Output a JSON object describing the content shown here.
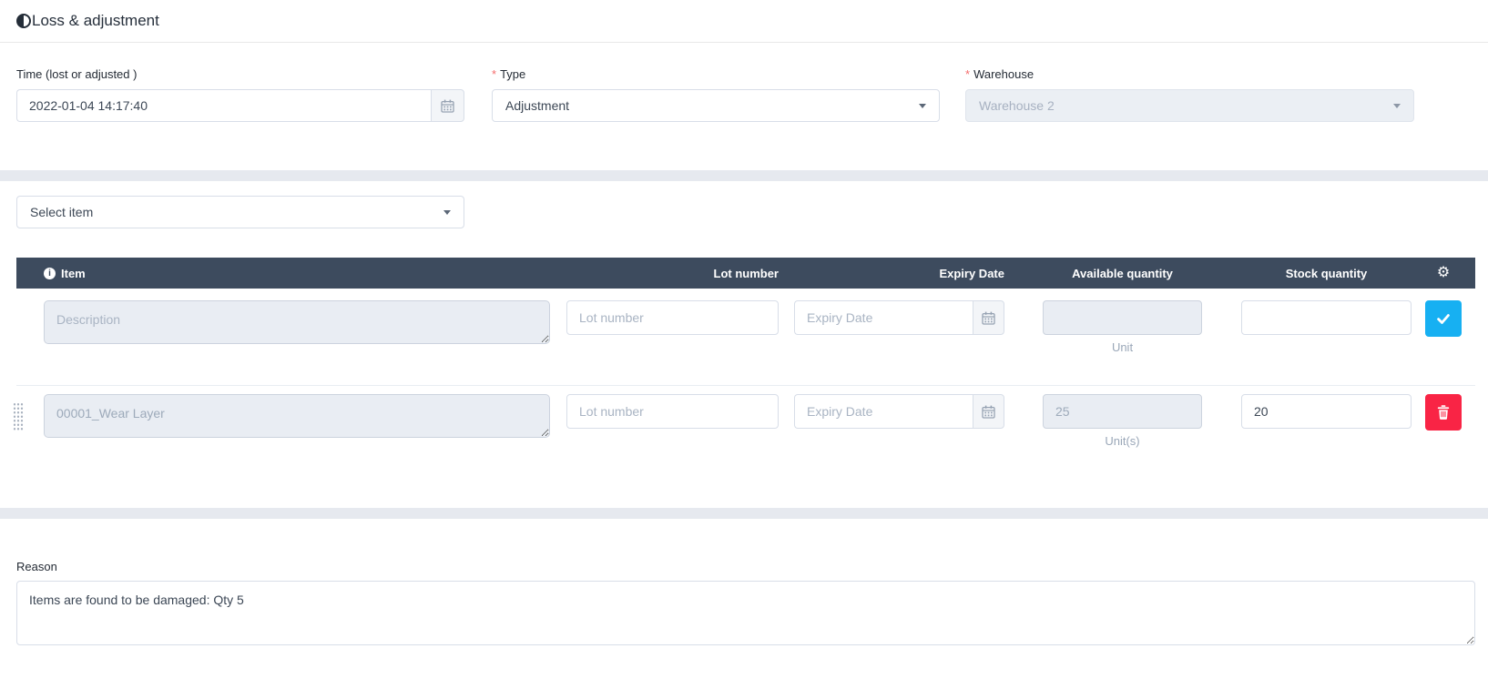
{
  "header": {
    "title": "Loss & adjustment"
  },
  "form": {
    "time": {
      "label": "Time (lost or adjusted )",
      "value": "2022-01-04 14:17:40"
    },
    "type": {
      "label": "Type",
      "required_mark": "*",
      "value": "Adjustment"
    },
    "warehouse": {
      "label": "Warehouse",
      "required_mark": "*",
      "value": "Warehouse 2"
    }
  },
  "item_picker": {
    "placeholder": "Select item"
  },
  "table": {
    "headers": {
      "item": "Item",
      "lot_number": "Lot number",
      "expiry_date": "Expiry Date",
      "available_quantity": "Available quantity",
      "stock_quantity": "Stock quantity"
    },
    "new_row": {
      "description_placeholder": "Description",
      "lot_placeholder": "Lot number",
      "expiry_placeholder": "Expiry Date",
      "available_value": "",
      "stock_value": "",
      "unit_label": "Unit"
    },
    "rows": [
      {
        "item": "00001_Wear Layer",
        "lot_placeholder": "Lot number",
        "expiry_placeholder": "Expiry Date",
        "available": "25",
        "stock": "20",
        "unit_label": "Unit(s)"
      }
    ]
  },
  "reason": {
    "label": "Reason",
    "value": "Items are found to be damaged: Qty 5"
  },
  "icons": {
    "info": "i",
    "settings": "⚙︎"
  },
  "colors": {
    "header_bar": "#3d4b5e",
    "accent_blue": "#17b0f2",
    "danger_red": "#f92445",
    "required_red": "#f56c6c",
    "band_gray": "#e6e9ef",
    "disabled_bg": "#e9edf3"
  }
}
